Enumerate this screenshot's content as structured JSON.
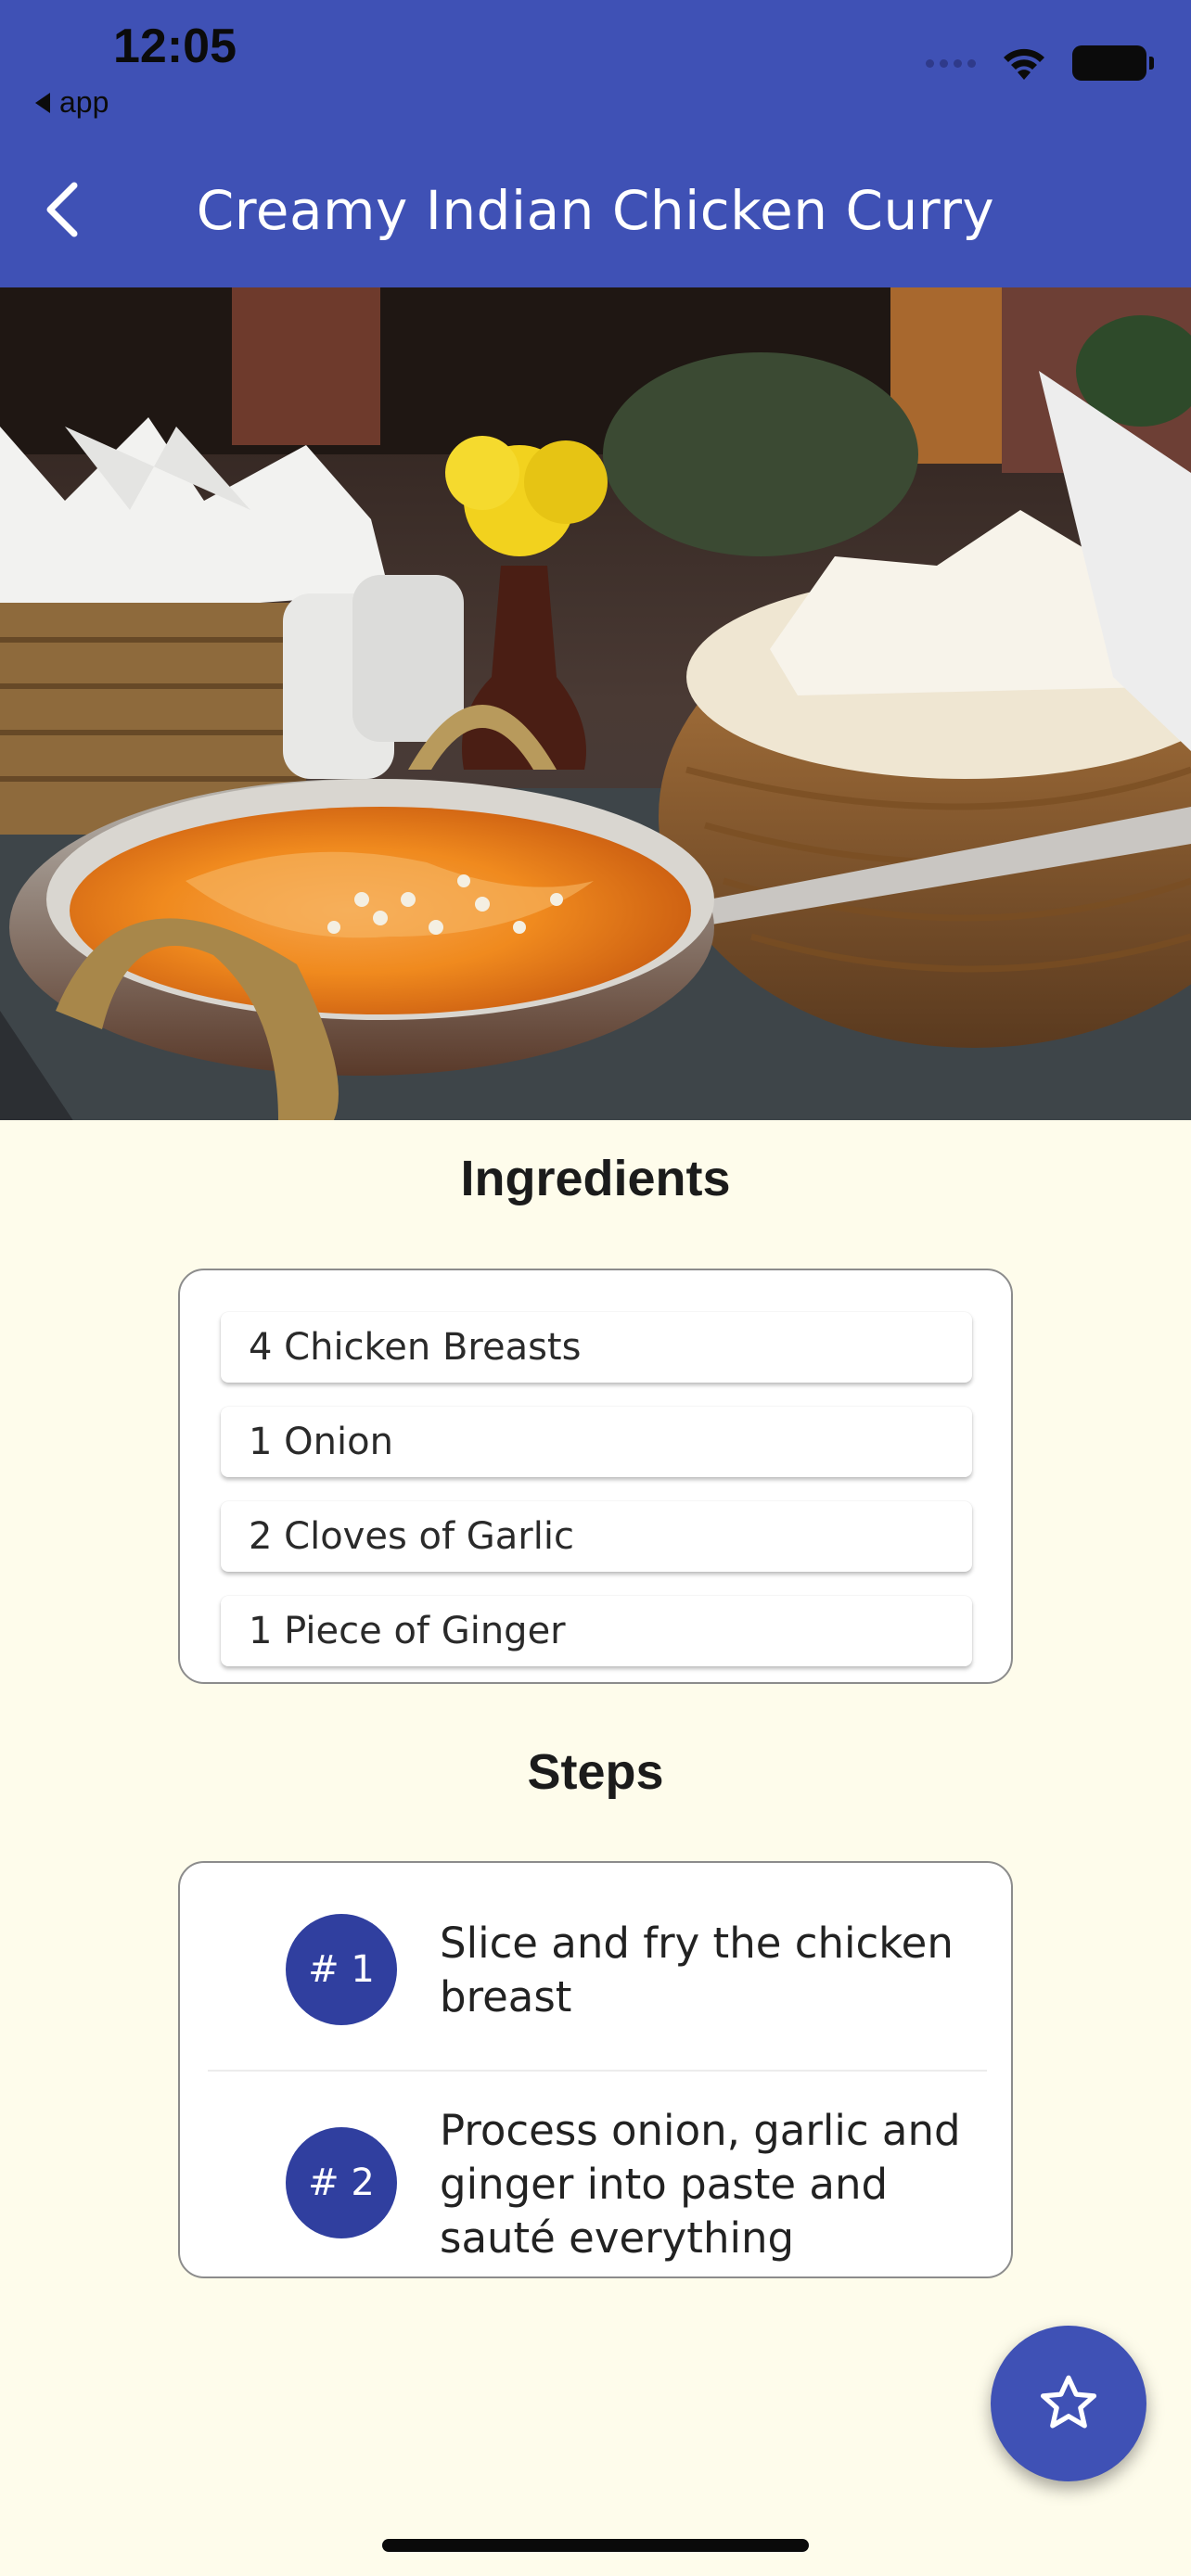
{
  "status_bar": {
    "time": "12:05",
    "back_to_app": "app"
  },
  "header": {
    "title": "Creamy Indian Chicken Curry",
    "back_icon": "chevron-left-icon"
  },
  "hero": {
    "icon": "recipe-photo"
  },
  "ingredients": {
    "title": "Ingredients",
    "items": [
      "4 Chicken Breasts",
      "1 Onion",
      "2 Cloves of Garlic",
      "1 Piece of Ginger"
    ]
  },
  "steps": {
    "title": "Steps",
    "items": [
      {
        "badge": "# 1",
        "text": "Slice and fry the chicken breast"
      },
      {
        "badge": "# 2",
        "text": "Process onion, garlic and ginger into paste and sauté everything"
      }
    ]
  },
  "fab": {
    "icon": "star-outline-icon"
  },
  "colors": {
    "primary": "#3F51B5",
    "badge": "#303F9F",
    "background": "#FEFCEB"
  }
}
